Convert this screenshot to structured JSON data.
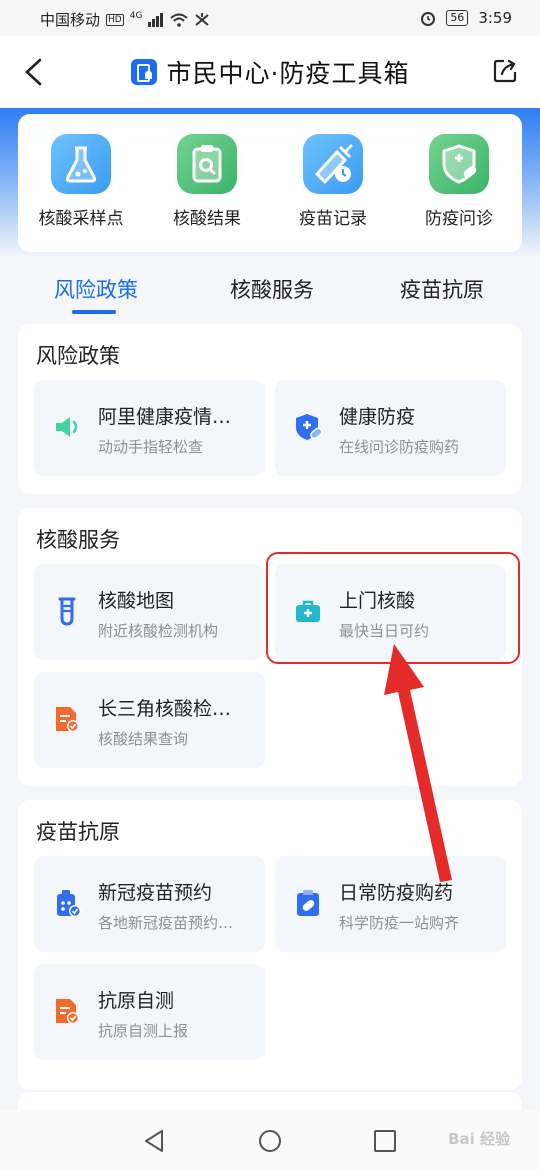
{
  "status_bar": {
    "carrier": "中国移动",
    "hd": "HD",
    "network": "4G",
    "battery": "56",
    "time": "3:59"
  },
  "header": {
    "title": "市民中心·防疫工具箱"
  },
  "tools": [
    {
      "label": "核酸采样点",
      "icon": "flask-icon"
    },
    {
      "label": "核酸结果",
      "icon": "clipboard-search-icon"
    },
    {
      "label": "疫苗记录",
      "icon": "vaccine-record-icon"
    },
    {
      "label": "防疫问诊",
      "icon": "medical-shield-icon"
    }
  ],
  "tabs": [
    {
      "label": "风险政策",
      "active": true
    },
    {
      "label": "核酸服务",
      "active": false
    },
    {
      "label": "疫苗抗原",
      "active": false
    }
  ],
  "sections": {
    "risk": {
      "title": "风险政策",
      "items": [
        {
          "title": "阿里健康疫情…",
          "subtitle": "动动手指轻松查",
          "icon": "speaker-icon"
        },
        {
          "title": "健康防疫",
          "subtitle": "在线问诊防疫购药",
          "icon": "shield-pill-icon"
        }
      ]
    },
    "nucleic": {
      "title": "核酸服务",
      "items": [
        {
          "title": "核酸地图",
          "subtitle": "附近核酸检测机构",
          "icon": "test-tube-icon"
        },
        {
          "title": "上门核酸",
          "subtitle": "最快当日可约",
          "icon": "medical-kit-icon"
        },
        {
          "title": "长三角核酸检…",
          "subtitle": "核酸结果查询",
          "icon": "document-check-icon"
        }
      ]
    },
    "vaccine": {
      "title": "疫苗抗原",
      "items": [
        {
          "title": "新冠疫苗预约",
          "subtitle": "各地新冠疫苗预约…",
          "icon": "vaccine-booking-icon"
        },
        {
          "title": "日常防疫购药",
          "subtitle": "科学防疫一站购齐",
          "icon": "clipboard-pill-icon"
        },
        {
          "title": "抗原自测",
          "subtitle": "抗原自测上报",
          "icon": "document-check-icon"
        }
      ]
    }
  },
  "watermark": "Bai 经验",
  "colors": {
    "accent": "#1a6df3",
    "highlight": "#e52a2a"
  }
}
